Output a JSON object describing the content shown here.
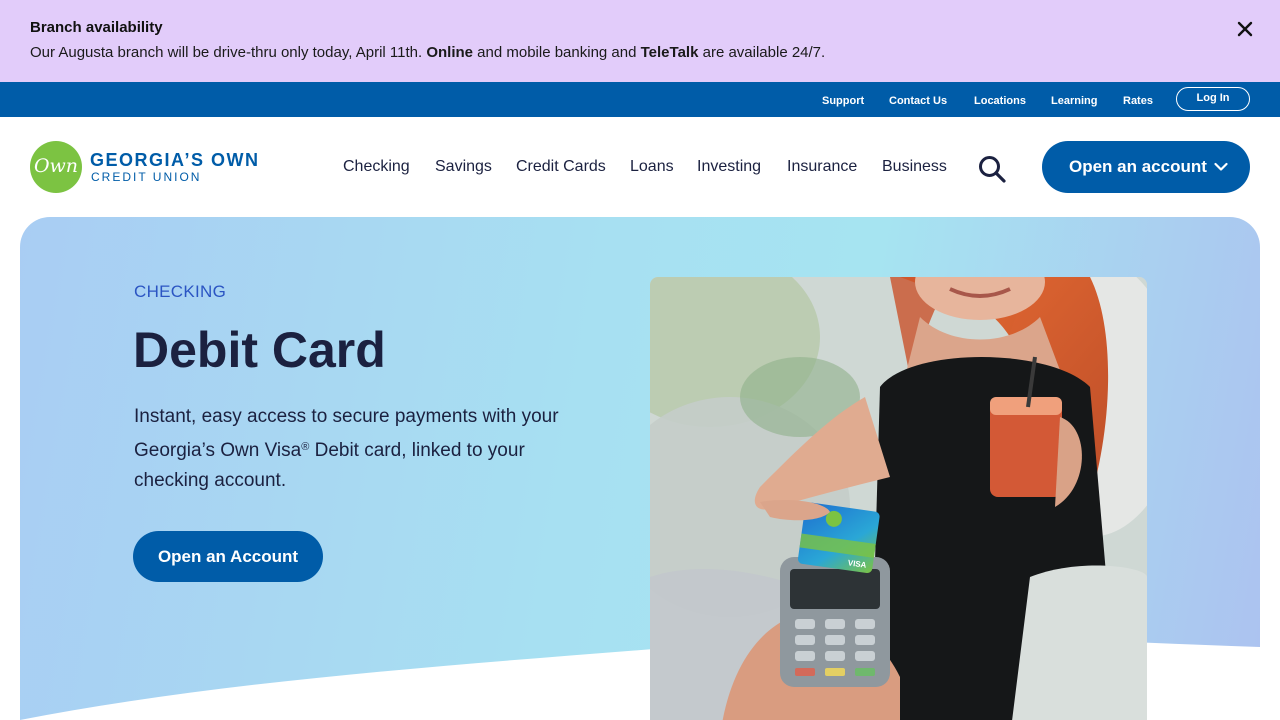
{
  "alert": {
    "title": "Branch availability",
    "message_start": "Our Augusta branch will be drive-thru only today, April 11th. ",
    "bold_1": "Online",
    "message_mid": " and mobile banking and ",
    "bold_2": "TeleTalk",
    "message_end": " are available 24/7."
  },
  "utility_nav": {
    "items": [
      "Support",
      "Contact Us",
      "Locations",
      "Learning",
      "Rates"
    ],
    "login_label": "Log In"
  },
  "brand": {
    "logo_mark": "Own",
    "name": "GEORGIA’S OWN",
    "sub": "CREDIT UNION",
    "logo_color": "#7cc342",
    "primary_color": "#005ca8"
  },
  "main_nav": {
    "items": [
      "Checking",
      "Savings",
      "Credit Cards",
      "Loans",
      "Investing",
      "Insurance",
      "Business"
    ],
    "open_account_label": "Open an account"
  },
  "hero": {
    "eyebrow": "CHECKING",
    "title": "Debit Card",
    "desc_1": "Instant, easy access to secure payments with your Georgia’s Own Visa",
    "desc_sup": "®",
    "desc_2": " Debit card, linked to your checking account.",
    "cta_label": "Open an Account",
    "image_alt": "Woman tapping debit card on payment terminal",
    "card_brand": "VISA"
  }
}
